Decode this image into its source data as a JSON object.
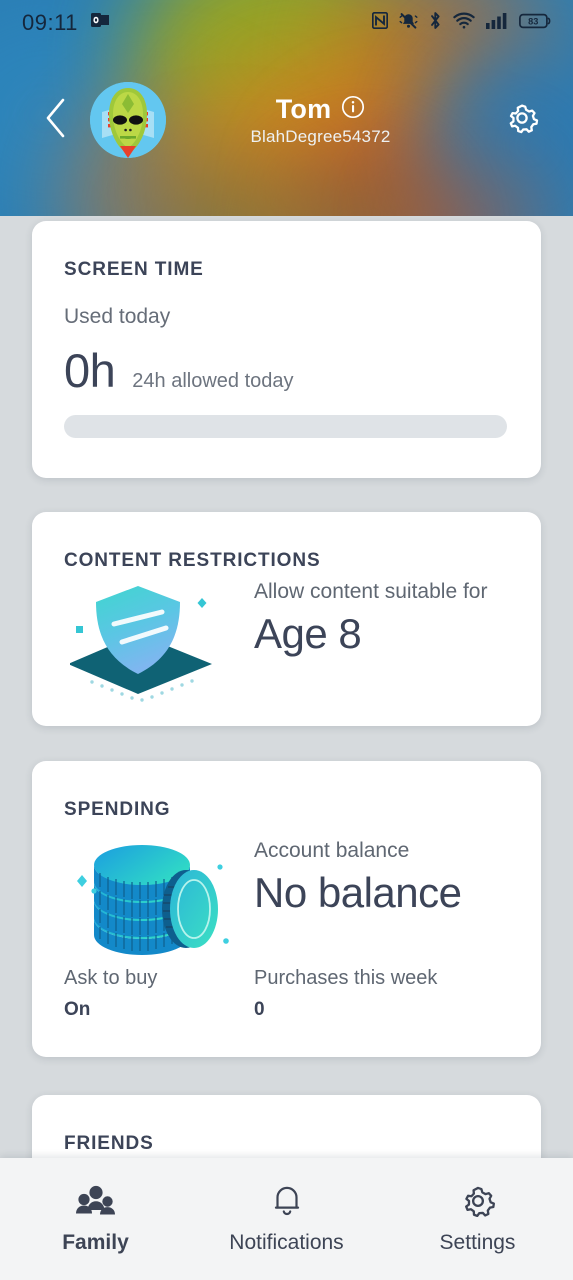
{
  "statusbar": {
    "time": "09:11",
    "icons_left": [
      "outlook-icon"
    ],
    "icons_right": [
      "nfc-icon",
      "ringer-silent-icon",
      "bluetooth-icon",
      "wifi-icon",
      "cellular-signal-icon",
      "battery-icon"
    ],
    "battery_level": "83"
  },
  "header": {
    "back_label": "back-chevron",
    "name": "Tom",
    "info_label": "i",
    "username": "BlahDegree54372",
    "settings_label": "settings-gear"
  },
  "cards": {
    "screen_time": {
      "title": "SCREEN TIME",
      "used_label": "Used today",
      "used_value": "0h",
      "allowed_text": "24h allowed today",
      "progress_percent": 0
    },
    "content_restrictions": {
      "title": "CONTENT RESTRICTIONS",
      "label": "Allow content suitable for",
      "value": "Age 8"
    },
    "spending": {
      "title": "SPENDING",
      "balance_label": "Account balance",
      "balance_value": "No balance",
      "ask_to_buy_label": "Ask to buy",
      "ask_to_buy_value": "On",
      "purchases_label": "Purchases this week",
      "purchases_value": "0"
    },
    "friends": {
      "title": "FRIENDS"
    }
  },
  "bottom_nav": {
    "items": [
      {
        "label": "Family",
        "icon": "family-group-icon",
        "active": true
      },
      {
        "label": "Notifications",
        "icon": "bell-icon",
        "active": false
      },
      {
        "label": "Settings",
        "icon": "gear-icon",
        "active": false
      }
    ]
  },
  "colors": {
    "page_background": "#d6dadd",
    "card_background": "#ffffff",
    "text_dark": "#3c4458",
    "text_muted": "#5f6772",
    "nav_background": "#f3f4f5",
    "progress_track": "#dfe3e7",
    "accent_teal": "#31b4c8",
    "header_blue": "#2b7fb5"
  }
}
